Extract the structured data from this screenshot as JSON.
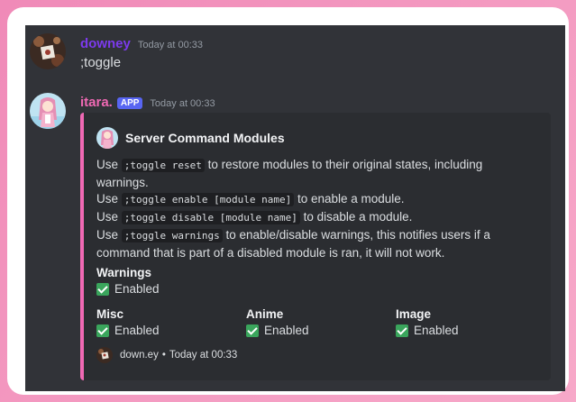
{
  "messages": [
    {
      "username": "downey",
      "username_color": "#7c3aed",
      "timestamp": "Today at 00:33",
      "content": ";toggle",
      "avatar_icon": "user-avatar-icon"
    },
    {
      "username": "itara.",
      "username_color": "#f069b4",
      "badge": "APP",
      "timestamp": "Today at 00:33",
      "avatar_icon": "bot-avatar-icon"
    }
  ],
  "embed": {
    "accent_color": "#f069b4",
    "author": "Server Command Modules",
    "description": {
      "l1_pre": "Use ",
      "l1_code": ";toggle reset",
      "l1_post": " to restore modules to their original states, including warnings.",
      "l2_pre": "Use ",
      "l2_code": ";toggle enable [module name]",
      "l2_post": " to enable a module.",
      "l3_pre": "Use ",
      "l3_code": ";toggle disable [module name]",
      "l3_post": " to disable a module.",
      "l4_pre": "Use ",
      "l4_code": ";toggle warnings",
      "l4_post": " to enable/disable warnings, this notifies users if a command that is part of a disabled module is ran, it will not work."
    },
    "fields": {
      "warnings": {
        "name": "Warnings",
        "value": "Enabled"
      },
      "misc": {
        "name": "Misc",
        "value": "Enabled"
      },
      "anime": {
        "name": "Anime",
        "value": "Enabled"
      },
      "image": {
        "name": "Image",
        "value": "Enabled"
      }
    },
    "footer": {
      "text": "down.ey",
      "separator": "•",
      "timestamp": "Today at 00:33"
    }
  }
}
